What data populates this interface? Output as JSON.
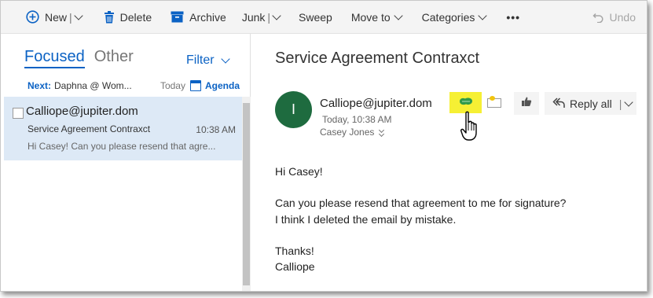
{
  "toolbar": {
    "new_label": "New",
    "delete_label": "Delete",
    "archive_label": "Archive",
    "junk_label": "Junk",
    "sweep_label": "Sweep",
    "move_to_label": "Move to",
    "categories_label": "Categories",
    "more_label": "•••",
    "undo_label": "Undo",
    "separator": "|"
  },
  "message_list": {
    "tabs": [
      {
        "label": "Focused",
        "selected": true
      },
      {
        "label": "Other",
        "selected": false
      }
    ],
    "filter_label": "Filter",
    "next": {
      "label": "Next:",
      "event": "Daphna @ Wom...",
      "day": "Today",
      "agenda_label": "Agenda"
    },
    "items": [
      {
        "from": "Calliope@jupiter.dom",
        "subject": "Service Agreement Contraxct",
        "time": "10:38 AM",
        "preview": "Hi Casey! Can you please resend that agre..."
      }
    ]
  },
  "reading_pane": {
    "subject": "Service Agreement Contraxct",
    "avatar_initial": "I",
    "sender": "Calliope@jupiter.dom",
    "sent_time": "Today, 10:38 AM",
    "recipient": "Casey Jones",
    "reply_all_label": "Reply all",
    "body": {
      "greeting": "Hi Casey!",
      "line1": "Can you please resend that agreement to me for signature?",
      "line2": "I think I deleted the email by mistake.",
      "closing": "Thanks!",
      "signature": "Calliope"
    }
  },
  "colors": {
    "accent": "#0b62c4",
    "avatar_bg": "#1e6b3f",
    "selected_row": "#dde9f6",
    "addin_highlight": "#f6f034"
  },
  "icons": [
    "plus-circle-icon",
    "trash-icon",
    "archive-icon",
    "calendar-icon",
    "addin-icon",
    "envelope-icon",
    "thumbs-up-icon",
    "reply-all-icon",
    "undo-icon",
    "hand-cursor-icon"
  ]
}
